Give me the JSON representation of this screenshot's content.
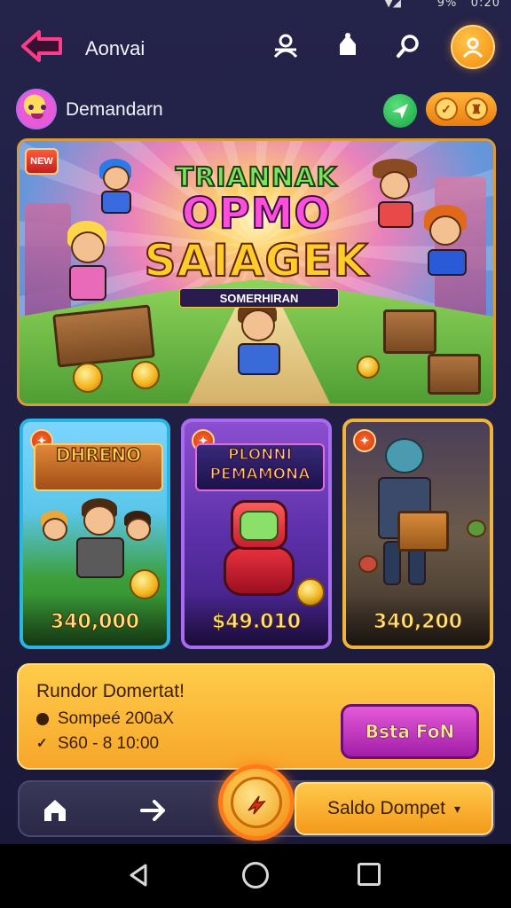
{
  "status_bar": {
    "battery_text": "9%",
    "time": "0:20"
  },
  "header": {
    "title": "Aonvai"
  },
  "subheader": {
    "title": "Demandarn"
  },
  "hero": {
    "badge": "NEW",
    "title_line1": "TRIANNAK",
    "title_line2": "OPMO",
    "title_line3": "SAIAGEK",
    "subtitle": "SOMERHIRAN"
  },
  "cards": [
    {
      "title": "DHRENO",
      "price": "340,000"
    },
    {
      "title": "PLONNI PEMAMONA",
      "price": "$49.010"
    },
    {
      "title": "",
      "price": "340,200"
    }
  ],
  "promo": {
    "title": "Rundor Domertat!",
    "item1": "Sompeé 200aX",
    "item2": "S60 - 8 10:00",
    "button": "Bsta FoN"
  },
  "bottom_nav": {
    "wallet_label": "Saldo Dompet"
  },
  "colors": {
    "accent_orange": "#f39a1a",
    "accent_magenta": "#e45ad8",
    "background": "#1f1d40"
  }
}
